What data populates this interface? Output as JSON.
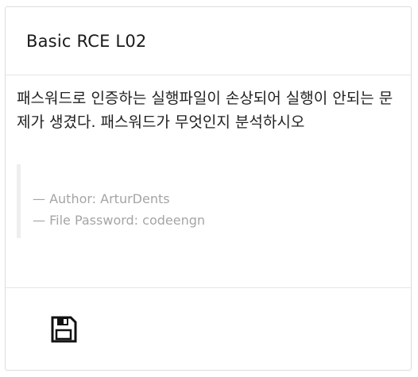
{
  "card": {
    "title": "Basic RCE L02",
    "description": "패스워드로 인증하는 실행파일이 손상되어 실행이 안되는 문제가 생겼다. 패스워드가 무엇인지 분석하시오",
    "author_line": "— Author: ArturDents",
    "password_line": "— File Password: codeengn"
  },
  "footer": {
    "download_icon": "floppy-disk-icon"
  }
}
